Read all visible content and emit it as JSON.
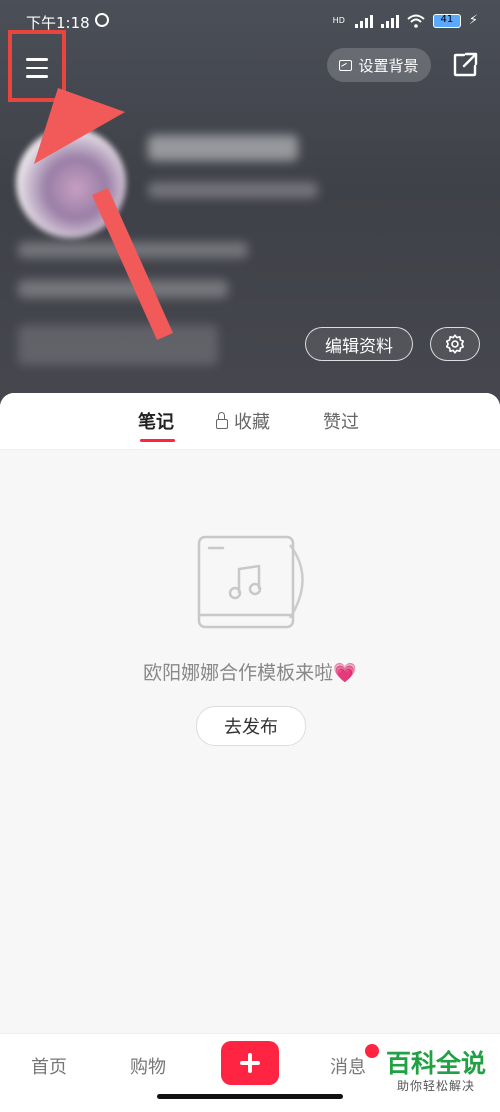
{
  "status_bar": {
    "time": "下午1:18",
    "hd": "HD",
    "battery": "41"
  },
  "header": {
    "set_background_label": "设置背景",
    "edit_profile_label": "编辑资料"
  },
  "tabs": [
    {
      "label": "笔记",
      "active": true
    },
    {
      "label": "收藏",
      "active": false
    },
    {
      "label": "赞过",
      "active": false
    }
  ],
  "empty_state": {
    "message": "欧阳娜娜合作模板来啦",
    "emoji": "💗",
    "publish_label": "去发布"
  },
  "bottom_nav": {
    "home": "首页",
    "shop": "购物",
    "messages": "消息"
  },
  "watermark": {
    "title": "百科全说",
    "subtitle": "助你轻松解决"
  },
  "colors": {
    "accent": "#ff2442",
    "highlight_box": "#e8453c",
    "arrow": "#f25a5a",
    "watermark_green": "#22a144"
  }
}
